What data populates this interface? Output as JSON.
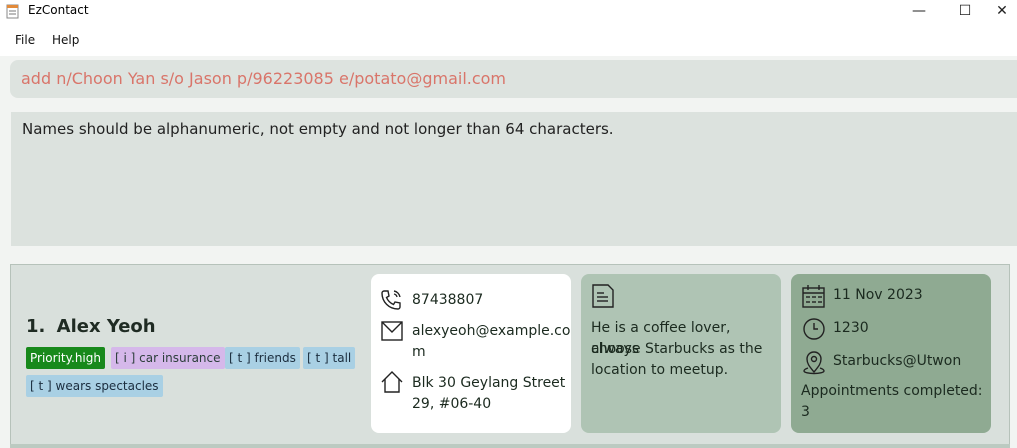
{
  "window": {
    "title": "EzContact",
    "controls": {
      "minimize": "—",
      "maximize": "☐",
      "close": "✕"
    },
    "icon": "app-notepad-icon"
  },
  "menu": {
    "items": [
      "File",
      "Help"
    ]
  },
  "command": {
    "value": "add n/Choon Yan s/o Jason p/96223085 e/potato@gmail.com",
    "error_color": "#d9756a"
  },
  "result": {
    "message": "Names should be alphanumeric, not empty and not longer than 64 characters."
  },
  "person": {
    "index": "1.",
    "name": "Alex Yeoh",
    "priority": "Priority.high",
    "insurance_tags": [
      "[ i ] car insurance"
    ],
    "tags": [
      "[ t ] friends",
      "[ t ] tall",
      "[ t ] wears spectacles"
    ],
    "phone": "87438807",
    "email_line1": "alexyeoh@example.co",
    "email_line2": "m",
    "address_line1": "Blk 30 Geylang Street",
    "address_line2": "29, #06-40",
    "note_lines": [
      "He is a coffee lover, always",
      "choose Starbucks as the",
      "location to meetup."
    ],
    "appointment": {
      "date": "11 Nov 2023",
      "time": "1230",
      "venue": "Starbucks@Utwon",
      "completed_label": "Appointments completed:",
      "completed_count": "3"
    }
  },
  "colors": {
    "priority_tag": "#18891b",
    "insurance_tag": "#d5b8ea",
    "tag": "#a9d0e4",
    "contact_card": "#ffffff",
    "note_card": "#afc4b4",
    "appointment_card": "#8faa92"
  }
}
